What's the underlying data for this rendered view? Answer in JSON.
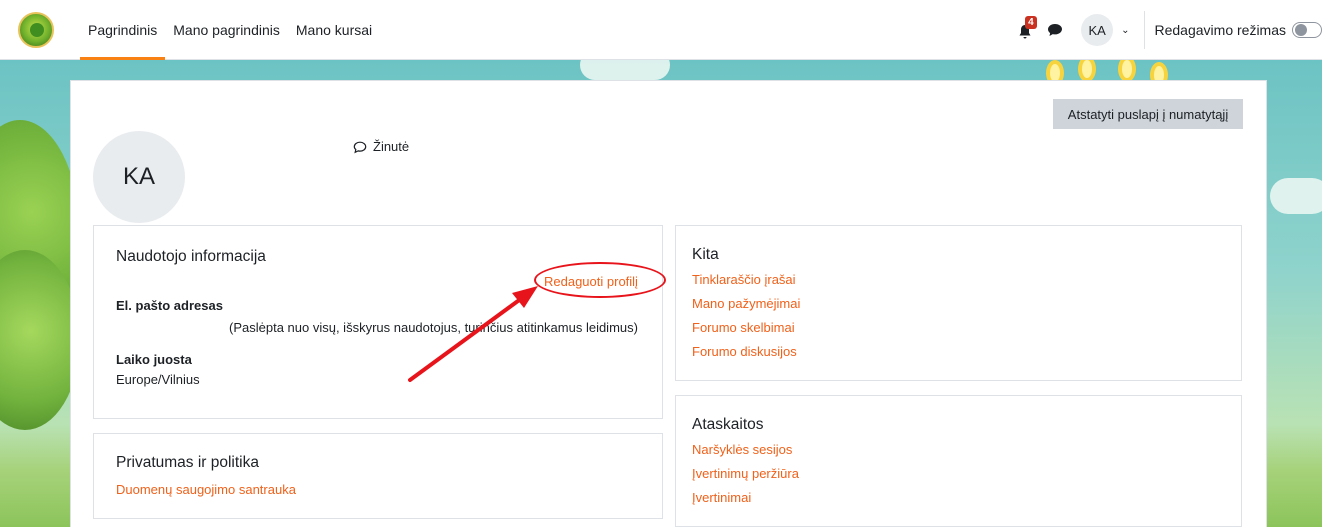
{
  "navbar": {
    "links": [
      "Pagrindinis",
      "Mano pagrindinis",
      "Mano kursai"
    ],
    "notification_count": "4",
    "user_initials": "KA",
    "edit_mode_label": "Redagavimo režimas"
  },
  "profile": {
    "reset_button": "Atstatyti puslapį į numatytąjį",
    "avatar_initials": "KA",
    "message_link": "Žinutė"
  },
  "user_info": {
    "title": "Naudotojo informacija",
    "edit_profile": "Redaguoti profilį",
    "email_label": "El. pašto adresas",
    "email_value": "(Paslėpta nuo visų, išskyrus naudotojus, turinčius atitinkamus leidimus)",
    "timezone_label": "Laiko juosta",
    "timezone_value": "Europe/Vilnius"
  },
  "privacy": {
    "title": "Privatumas ir politika",
    "link": "Duomenų saugojimo santrauka"
  },
  "other": {
    "title": "Kita",
    "links": [
      "Tinklaraščio įrašai",
      "Mano pažymėjimai",
      "Forumo skelbimai",
      "Forumo diskusijos"
    ]
  },
  "reports": {
    "title": "Ataskaitos",
    "links": [
      "Naršyklės sesijos",
      "Įvertinimų peržiūra",
      "Įvertinimai"
    ]
  },
  "colors": {
    "link": "#f0611a",
    "accent": "#f98012",
    "annotation": "#e8141b"
  }
}
